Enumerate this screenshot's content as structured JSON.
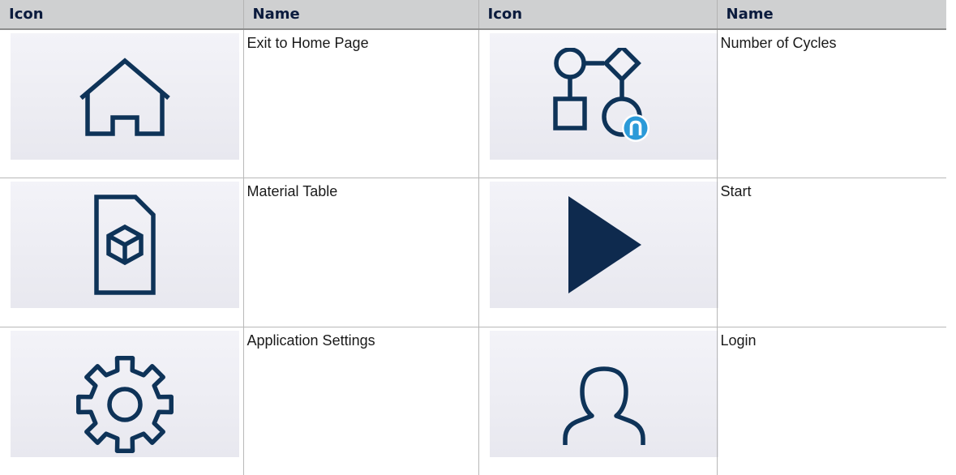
{
  "table": {
    "headers": [
      "Icon",
      "Name",
      "Icon",
      "Name"
    ],
    "rows": [
      [
        {
          "icon": "home-icon",
          "name": "Exit to Home Page"
        },
        {
          "icon": "number-of-cycles-icon",
          "name": "Number of Cycles"
        }
      ],
      [
        {
          "icon": "material-table-icon",
          "name": "Material Table"
        },
        {
          "icon": "play-icon",
          "name": "Start"
        }
      ],
      [
        {
          "icon": "gear-icon",
          "name": "Application Settings"
        },
        {
          "icon": "user-icon",
          "name": "Login"
        }
      ]
    ]
  },
  "colors": {
    "icon_stroke": "#0e3358",
    "header_bg": "#cfd0d1",
    "tile_bg": "#eeeef4",
    "badge_blue": "#2b9ad8"
  }
}
